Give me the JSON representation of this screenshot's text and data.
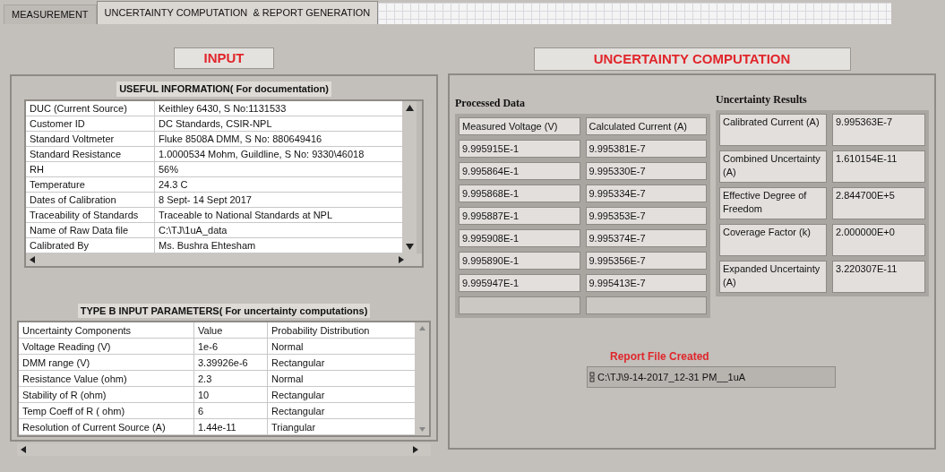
{
  "tabs": [
    {
      "label": "MEASUREMENT",
      "selected": false
    },
    {
      "label": "UNCERTAINTY COMPUTATION  & REPORT GENERATION",
      "selected": true
    }
  ],
  "input": {
    "title": "INPUT",
    "useful_information": {
      "title": "USEFUL INFORMATION( For documentation)",
      "rows": [
        {
          "label": "DUC (Current Source)",
          "value": "Keithley 6430, S No:1131533"
        },
        {
          "label": "Customer ID",
          "value": "DC Standards, CSIR-NPL"
        },
        {
          "label": "Standard Voltmeter",
          "value": "Fluke 8508A DMM, S No: 880649416"
        },
        {
          "label": "Standard Resistance",
          "value": "1.0000534 Mohm, Guildline, S No: 9330\\46018"
        },
        {
          "label": "RH",
          "value": "56%"
        },
        {
          "label": "Temperature",
          "value": "24.3 C"
        },
        {
          "label": "Dates of Calibration",
          "value": "8 Sept- 14 Sept 2017"
        },
        {
          "label": "Traceability of Standards",
          "value": "Traceable to National Standards at NPL"
        },
        {
          "label": "Name of Raw Data file",
          "value": "C:\\TJ\\1uA_data"
        },
        {
          "label": "Calibrated By",
          "value": "Ms. Bushra Ehtesham"
        }
      ]
    },
    "type_b": {
      "title": "TYPE B INPUT PARAMETERS( For uncertainty computations)",
      "columns": [
        "Uncertainty Components",
        "Value",
        "Probability Distribution"
      ],
      "rows": [
        [
          "Voltage Reading (V)",
          "1e-6",
          "Normal"
        ],
        [
          "DMM range (V)",
          "3.39926e-6",
          "Rectangular"
        ],
        [
          "Resistance  Value (ohm)",
          "2.3",
          "Normal"
        ],
        [
          "Stability of R (ohm)",
          "10",
          "Rectangular"
        ],
        [
          "Temp Coeff of R ( ohm)",
          "6",
          "Rectangular"
        ],
        [
          "Resolution of Current  Source (A)",
          "1.44e-11",
          "Triangular"
        ]
      ]
    }
  },
  "computation": {
    "title": "UNCERTAINTY COMPUTATION",
    "processed_data": {
      "title": "Processed Data",
      "columns": [
        "Measured Voltage  (V)",
        "Calculated Current (A)"
      ],
      "rows": [
        [
          "9.995915E-1",
          "9.995381E-7"
        ],
        [
          "9.995864E-1",
          "9.995330E-7"
        ],
        [
          "9.995868E-1",
          "9.995334E-7"
        ],
        [
          "9.995887E-1",
          "9.995353E-7"
        ],
        [
          "9.995908E-1",
          "9.995374E-7"
        ],
        [
          "9.995890E-1",
          "9.995356E-7"
        ],
        [
          "9.995947E-1",
          "9.995413E-7"
        ]
      ]
    },
    "results": {
      "title": "Uncertainty Results",
      "rows": [
        {
          "label": "Calibrated Current (A)",
          "value": "9.995363E-7"
        },
        {
          "label": "Combined Uncertainty (A)",
          "value": "1.610154E-11"
        },
        {
          "label": "Effective Degree of Freedom",
          "value": "2.844700E+5"
        },
        {
          "label": "Coverage Factor (k)",
          "value": "2.000000E+0"
        },
        {
          "label": "Expanded Uncertainty (A)",
          "value": "3.220307E-11"
        }
      ]
    },
    "report": {
      "label": "Report File Created",
      "path": "C:\\TJ\\9-14-2017_12-31 PM__1uA"
    }
  }
}
